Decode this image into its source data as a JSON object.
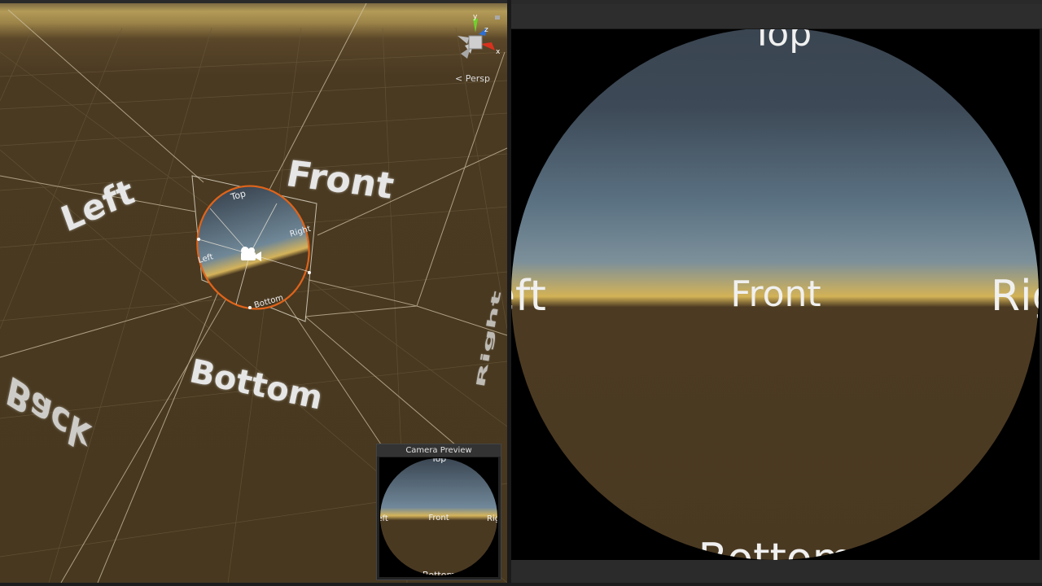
{
  "scene_view": {
    "labels": {
      "front": "Front",
      "left": "Left",
      "bottom": "Bottom",
      "back": "Back",
      "right_partial": "Right"
    },
    "mini_labels": {
      "top": "Top",
      "left": "Left",
      "right": "Right",
      "bottom": "Bottom"
    },
    "gizmo": {
      "y": "y",
      "z": "z",
      "x": "x"
    },
    "projection": "< Persp",
    "colors": {
      "ground": "#47381f",
      "horizon": "#b39b58",
      "camera_outline": "#e0641a"
    }
  },
  "camera_preview": {
    "title": "Camera Preview",
    "labels": {
      "top": "Top",
      "front": "Front",
      "left": "Left",
      "right": "Right",
      "bottom": "Bottom"
    }
  },
  "game_view": {
    "labels": {
      "top": "Top",
      "front": "Front",
      "left": "Left",
      "right": "Right",
      "bottom": "Bottom"
    },
    "colors": {
      "sky_top": "#39444f",
      "sky_mid": "#6e8696",
      "horizon": "#d3b257",
      "ground": "#4a3921"
    }
  }
}
